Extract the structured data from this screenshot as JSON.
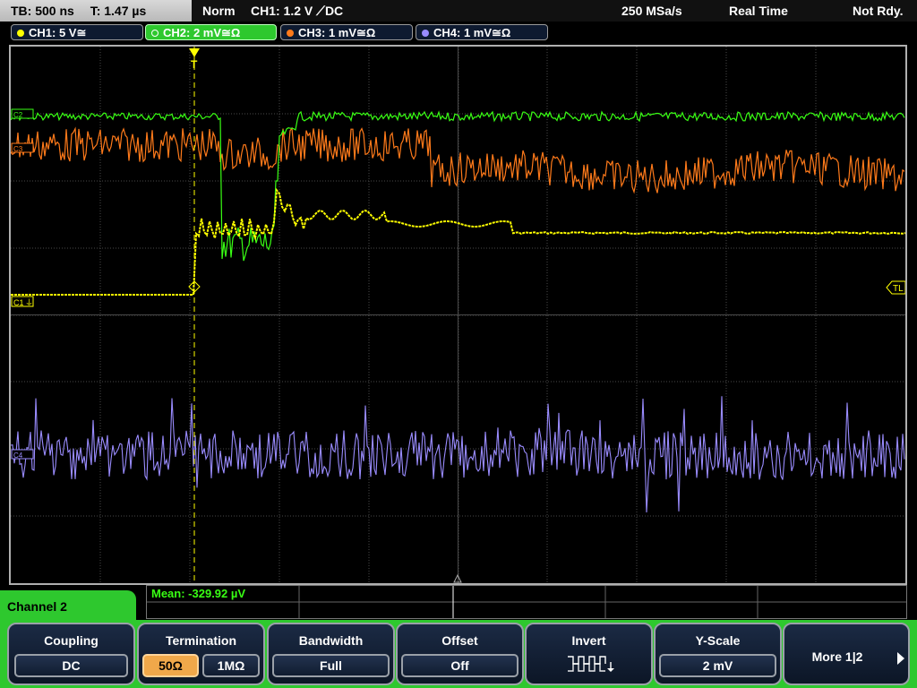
{
  "topbar": {
    "timebase": "TB: 500 ns",
    "trigger_time": "T: 1.47 µs",
    "mode": "Norm",
    "trigger_info": "CH1: 1.2 V ⟋DC",
    "sample_rate": "250 MSa/s",
    "acq_mode": "Real Time",
    "status": "Not Rdy."
  },
  "channels": [
    {
      "label": "CH1: 5 V≅",
      "color": "#ffff00"
    },
    {
      "label": "CH2: 2 mV≅Ω",
      "color": "#39ff14"
    },
    {
      "label": "CH3: 1 mV≅Ω",
      "color": "#ff7a1a"
    },
    {
      "label": "CH4: 1 mV≅Ω",
      "color": "#9a8cff"
    }
  ],
  "markers": {
    "ch1_ground": "C1",
    "ch2_marker": "C2",
    "ch3_marker": "C3",
    "ch4_marker": "C4",
    "trigger_level": "TL",
    "trigger_pos": "T"
  },
  "measurement": {
    "mean": "Mean: -329.92 µV"
  },
  "channel_menu": {
    "title": "Channel 2"
  },
  "softkeys": {
    "coupling": {
      "title": "Coupling",
      "value": "DC"
    },
    "termination": {
      "title": "Termination",
      "opt1": "50Ω",
      "opt2": "1MΩ"
    },
    "bandwidth": {
      "title": "Bandwidth",
      "value": "Full"
    },
    "offset": {
      "title": "Offset",
      "value": "Off"
    },
    "invert": {
      "title": "Invert"
    },
    "yscale": {
      "title": "Y-Scale",
      "value": "2 mV"
    },
    "more": {
      "title": "More 1|2"
    }
  }
}
